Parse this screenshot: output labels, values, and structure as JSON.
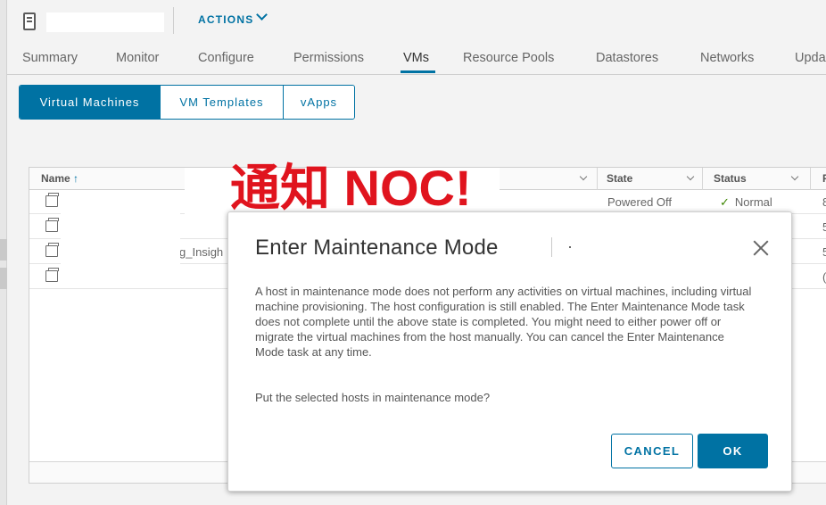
{
  "header": {
    "actions_label": "ACTIONS"
  },
  "tabs": [
    {
      "label": "Summary"
    },
    {
      "label": "Monitor"
    },
    {
      "label": "Configure"
    },
    {
      "label": "Permissions"
    },
    {
      "label": "VMs"
    },
    {
      "label": "Resource Pools"
    },
    {
      "label": "Datastores"
    },
    {
      "label": "Networks"
    },
    {
      "label": "Upda"
    }
  ],
  "segments": [
    {
      "label": "Virtual Machines"
    },
    {
      "label": "VM Templates"
    },
    {
      "label": "vApps"
    }
  ],
  "grid": {
    "columns": {
      "name": "Name",
      "sort_arrow": "↑",
      "state": "State",
      "status": "Status",
      "extra": "P"
    },
    "rows": [
      {
        "name_fragment": "",
        "state": "Powered Off",
        "status": "Normal",
        "extra": "8"
      },
      {
        "name_fragment": "",
        "state": "",
        "status": "",
        "extra": "5"
      },
      {
        "name_fragment": "g_Insigh",
        "state": "",
        "status": "",
        "extra": "5"
      },
      {
        "name_fragment": "",
        "state": "",
        "status": "",
        "extra": "("
      }
    ]
  },
  "annotation": "通知 NOC!",
  "modal": {
    "title": "Enter Maintenance Mode",
    "body": "A host in maintenance mode does not perform any activities on virtual machines, including virtual machine provisioning. The host configuration is still enabled. The Enter Maintenance Mode task does not complete until the above state is completed. You might need to either power off or migrate the virtual machines from the host manually. You can cancel the Enter Maintenance Mode task at any time.",
    "question": "Put the selected hosts in maintenance mode?",
    "cancel_label": "CANCEL",
    "ok_label": "OK"
  },
  "colors": {
    "accent": "#0072a3",
    "annotation": "#e0141e",
    "status_ok": "#3c8500"
  }
}
